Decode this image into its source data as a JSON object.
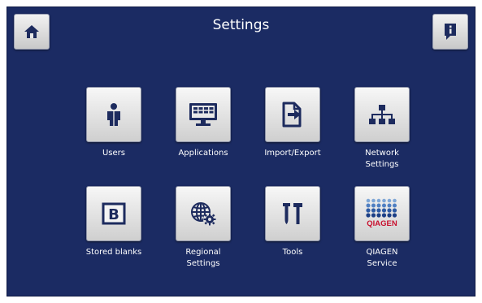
{
  "header": {
    "title": "Settings"
  },
  "icons": {
    "home": "home-icon",
    "info": "info-icon"
  },
  "tiles": [
    {
      "label": "Users",
      "icon": "user-icon"
    },
    {
      "label": "Applications",
      "icon": "monitor-icon"
    },
    {
      "label": "Import/Export",
      "icon": "file-export-icon"
    },
    {
      "label": "Network\nSettings",
      "icon": "network-icon"
    },
    {
      "label": "Stored blanks",
      "icon": "blank-icon"
    },
    {
      "label": "Regional\nSettings",
      "icon": "globe-gear-icon"
    },
    {
      "label": "Tools",
      "icon": "tools-icon"
    },
    {
      "label": "QIAGEN\nService",
      "icon": "qiagen-logo"
    }
  ],
  "logo": {
    "text": "QIAGEN"
  },
  "blank_icon_letter": "B",
  "colors": {
    "background": "#1b2b63",
    "icon": "#1d2b5e",
    "tile": "#e6e6e6",
    "qiagen_red": "#c8102e"
  }
}
